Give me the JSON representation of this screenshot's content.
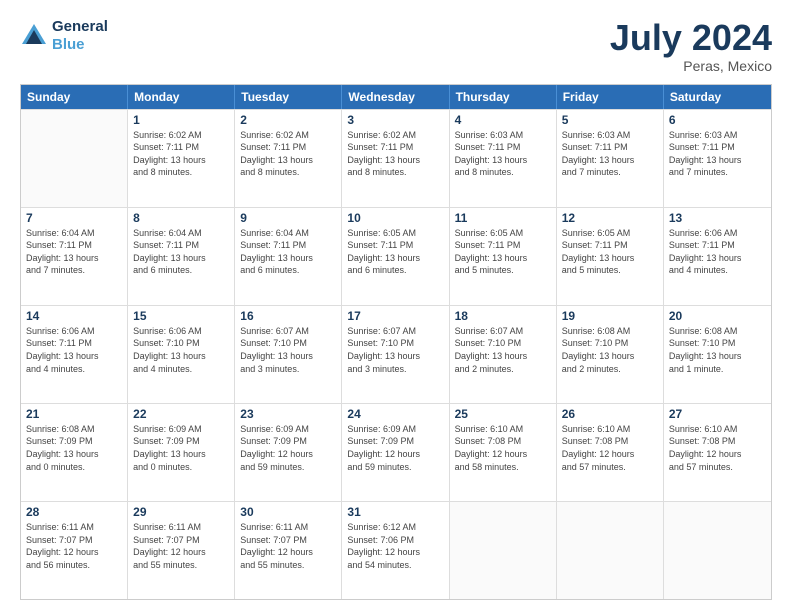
{
  "header": {
    "logo_line1": "General",
    "logo_line2": "Blue",
    "title": "July 2024",
    "subtitle": "Peras, Mexico"
  },
  "days_of_week": [
    "Sunday",
    "Monday",
    "Tuesday",
    "Wednesday",
    "Thursday",
    "Friday",
    "Saturday"
  ],
  "weeks": [
    [
      {
        "day": "",
        "info": ""
      },
      {
        "day": "1",
        "info": "Sunrise: 6:02 AM\nSunset: 7:11 PM\nDaylight: 13 hours\nand 8 minutes."
      },
      {
        "day": "2",
        "info": "Sunrise: 6:02 AM\nSunset: 7:11 PM\nDaylight: 13 hours\nand 8 minutes."
      },
      {
        "day": "3",
        "info": "Sunrise: 6:02 AM\nSunset: 7:11 PM\nDaylight: 13 hours\nand 8 minutes."
      },
      {
        "day": "4",
        "info": "Sunrise: 6:03 AM\nSunset: 7:11 PM\nDaylight: 13 hours\nand 8 minutes."
      },
      {
        "day": "5",
        "info": "Sunrise: 6:03 AM\nSunset: 7:11 PM\nDaylight: 13 hours\nand 7 minutes."
      },
      {
        "day": "6",
        "info": "Sunrise: 6:03 AM\nSunset: 7:11 PM\nDaylight: 13 hours\nand 7 minutes."
      }
    ],
    [
      {
        "day": "7",
        "info": "Sunrise: 6:04 AM\nSunset: 7:11 PM\nDaylight: 13 hours\nand 7 minutes."
      },
      {
        "day": "8",
        "info": "Sunrise: 6:04 AM\nSunset: 7:11 PM\nDaylight: 13 hours\nand 6 minutes."
      },
      {
        "day": "9",
        "info": "Sunrise: 6:04 AM\nSunset: 7:11 PM\nDaylight: 13 hours\nand 6 minutes."
      },
      {
        "day": "10",
        "info": "Sunrise: 6:05 AM\nSunset: 7:11 PM\nDaylight: 13 hours\nand 6 minutes."
      },
      {
        "day": "11",
        "info": "Sunrise: 6:05 AM\nSunset: 7:11 PM\nDaylight: 13 hours\nand 5 minutes."
      },
      {
        "day": "12",
        "info": "Sunrise: 6:05 AM\nSunset: 7:11 PM\nDaylight: 13 hours\nand 5 minutes."
      },
      {
        "day": "13",
        "info": "Sunrise: 6:06 AM\nSunset: 7:11 PM\nDaylight: 13 hours\nand 4 minutes."
      }
    ],
    [
      {
        "day": "14",
        "info": "Sunrise: 6:06 AM\nSunset: 7:11 PM\nDaylight: 13 hours\nand 4 minutes."
      },
      {
        "day": "15",
        "info": "Sunrise: 6:06 AM\nSunset: 7:10 PM\nDaylight: 13 hours\nand 4 minutes."
      },
      {
        "day": "16",
        "info": "Sunrise: 6:07 AM\nSunset: 7:10 PM\nDaylight: 13 hours\nand 3 minutes."
      },
      {
        "day": "17",
        "info": "Sunrise: 6:07 AM\nSunset: 7:10 PM\nDaylight: 13 hours\nand 3 minutes."
      },
      {
        "day": "18",
        "info": "Sunrise: 6:07 AM\nSunset: 7:10 PM\nDaylight: 13 hours\nand 2 minutes."
      },
      {
        "day": "19",
        "info": "Sunrise: 6:08 AM\nSunset: 7:10 PM\nDaylight: 13 hours\nand 2 minutes."
      },
      {
        "day": "20",
        "info": "Sunrise: 6:08 AM\nSunset: 7:10 PM\nDaylight: 13 hours\nand 1 minute."
      }
    ],
    [
      {
        "day": "21",
        "info": "Sunrise: 6:08 AM\nSunset: 7:09 PM\nDaylight: 13 hours\nand 0 minutes."
      },
      {
        "day": "22",
        "info": "Sunrise: 6:09 AM\nSunset: 7:09 PM\nDaylight: 13 hours\nand 0 minutes."
      },
      {
        "day": "23",
        "info": "Sunrise: 6:09 AM\nSunset: 7:09 PM\nDaylight: 12 hours\nand 59 minutes."
      },
      {
        "day": "24",
        "info": "Sunrise: 6:09 AM\nSunset: 7:09 PM\nDaylight: 12 hours\nand 59 minutes."
      },
      {
        "day": "25",
        "info": "Sunrise: 6:10 AM\nSunset: 7:08 PM\nDaylight: 12 hours\nand 58 minutes."
      },
      {
        "day": "26",
        "info": "Sunrise: 6:10 AM\nSunset: 7:08 PM\nDaylight: 12 hours\nand 57 minutes."
      },
      {
        "day": "27",
        "info": "Sunrise: 6:10 AM\nSunset: 7:08 PM\nDaylight: 12 hours\nand 57 minutes."
      }
    ],
    [
      {
        "day": "28",
        "info": "Sunrise: 6:11 AM\nSunset: 7:07 PM\nDaylight: 12 hours\nand 56 minutes."
      },
      {
        "day": "29",
        "info": "Sunrise: 6:11 AM\nSunset: 7:07 PM\nDaylight: 12 hours\nand 55 minutes."
      },
      {
        "day": "30",
        "info": "Sunrise: 6:11 AM\nSunset: 7:07 PM\nDaylight: 12 hours\nand 55 minutes."
      },
      {
        "day": "31",
        "info": "Sunrise: 6:12 AM\nSunset: 7:06 PM\nDaylight: 12 hours\nand 54 minutes."
      },
      {
        "day": "",
        "info": ""
      },
      {
        "day": "",
        "info": ""
      },
      {
        "day": "",
        "info": ""
      }
    ]
  ]
}
